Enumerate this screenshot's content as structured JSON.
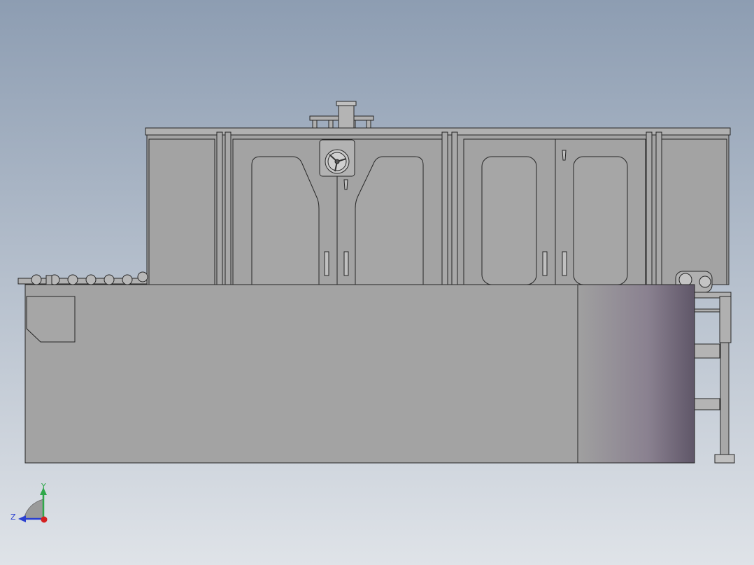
{
  "view": {
    "background_top": "#8d9db2",
    "background_bottom": "#dfe3e8",
    "part_fill": "#a3a3a3",
    "part_light": "#b0b0b0",
    "edge_color": "#262626",
    "shade_dark": "#5f5668",
    "shade_light": "#a0a0a0"
  },
  "triad": {
    "y_label": "Y",
    "z_label": "Z",
    "y_color": "#2fa84a",
    "z_color": "#2a3fd0",
    "x_color": "#d42020"
  }
}
